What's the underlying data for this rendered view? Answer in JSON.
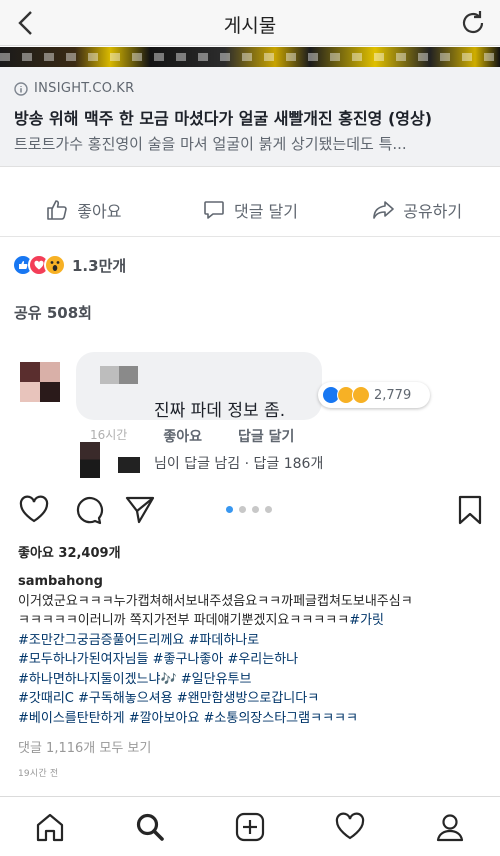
{
  "header": {
    "title": "게시물",
    "back_icon": "chevron-left-icon",
    "refresh_icon": "refresh-icon"
  },
  "link_card": {
    "source": "INSIGHT.CO.KR",
    "headline": "방송 위해 맥주 한 모금 마셨다가 얼굴 새빨개진 홍진영 (영상)",
    "description": "트로트가수 홍진영이 술을 마셔 얼굴이 붉게 상기됐는데도 특..."
  },
  "actions": {
    "like": "좋아요",
    "comment": "댓글 달기",
    "share": "공유하기"
  },
  "reactions": {
    "count": "1.3만개",
    "colors": {
      "like": "#1877f2",
      "love": "#f33e58",
      "wow": "#f7b125"
    }
  },
  "share_count": "공유 508회",
  "top_comment": {
    "text": "진짜 파데 정보 좀.",
    "reaction_count": "2,779",
    "time": "16시간",
    "like_label": "좋아요",
    "reply_label": "답글 달기",
    "reply_summary": "님이 답글 남김 · 답글 186개"
  },
  "instagram": {
    "likes": "좋아요 32,409개",
    "username": "sambahong",
    "caption_lines": [
      "이거였군요ㅋㅋㅋ누가캡쳐해서보내주셨음요ㅋㅋ까페글캡쳐도보내주심ㅋ",
      "ㅋㅋㅋㅋㅋ이러니까 쪽지가전부 파데얘기뿐겠지요ㅋㅋㅋㅋㅋ",
      "#조만간그궁금증풀어드리께요 #파데하나로",
      "#모두하나가된여자님들 #좋구나좋아 #우리는하나",
      "#하나면하나지둘이겠느냐🎶 #일단유투브",
      "#갓때리C #구독해놓으셔용 #왠만함생방으로갑니다ㅋ",
      "#베이스를탄탄하게 #깔아보아요 #소통의장스타그램ㅋㅋㅋㅋ"
    ],
    "line2_tag": "#가릿",
    "view_comments": "댓글 1,116개 모두 보기",
    "time_ago": "19시간 전",
    "accent": "#3897f0",
    "hashtag_color": "#003569"
  },
  "tabbar": {
    "icons": [
      "home-icon",
      "search-icon",
      "add-post-icon",
      "activity-heart-icon",
      "profile-icon"
    ]
  }
}
